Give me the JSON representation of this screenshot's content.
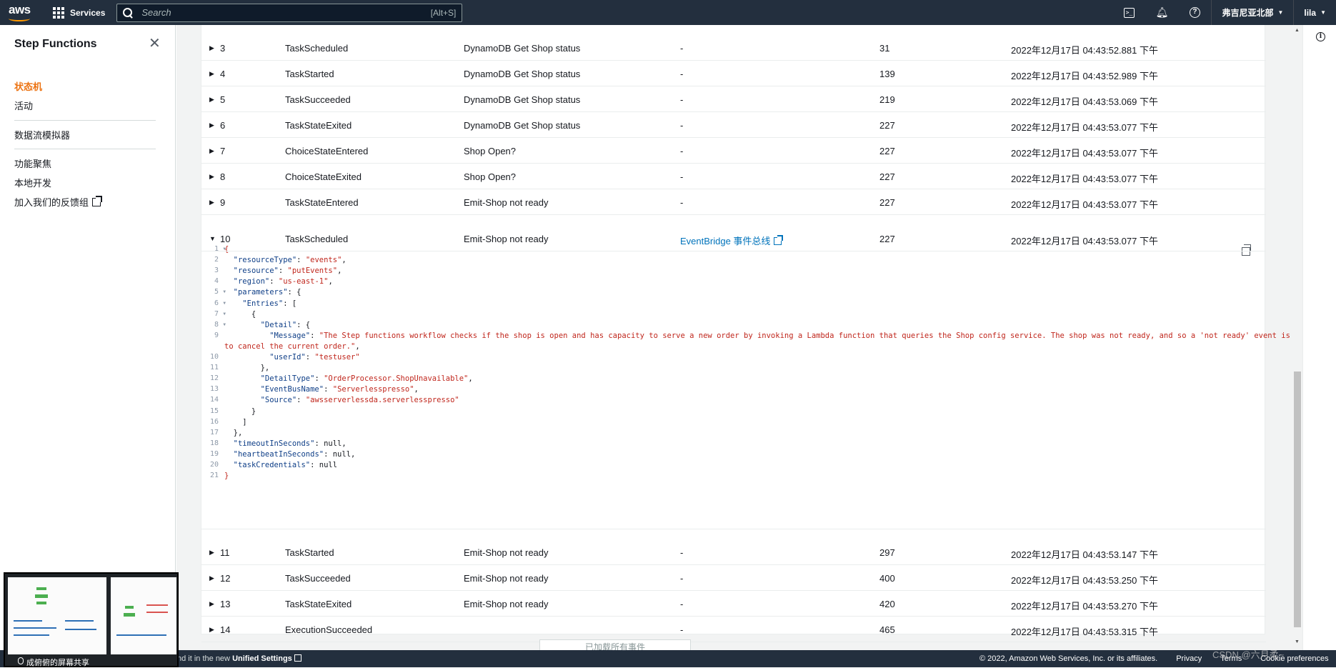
{
  "topnav": {
    "logo_text": "aws",
    "services_label": "Services",
    "search_placeholder": "Search",
    "search_shortcut": "[Alt+S]",
    "region": "弗吉尼亚北部",
    "user": "lila"
  },
  "sidebar": {
    "title": "Step Functions",
    "items": [
      {
        "label": "状态机",
        "active": true
      },
      {
        "label": "活动"
      },
      {
        "label": "数据流模拟器"
      },
      {
        "label": "功能聚焦"
      },
      {
        "label": "本地开发"
      },
      {
        "label": "加入我们的反馈组"
      }
    ]
  },
  "events": [
    {
      "id": "3",
      "type": "TaskScheduled",
      "step": "DynamoDB Get Shop status",
      "resource": "-",
      "elapsed_ms": "31",
      "timestamp": "2022年12月17日 04:43:52.881 下午",
      "expanded": false
    },
    {
      "id": "4",
      "type": "TaskStarted",
      "step": "DynamoDB Get Shop status",
      "resource": "-",
      "elapsed_ms": "139",
      "timestamp": "2022年12月17日 04:43:52.989 下午",
      "expanded": false
    },
    {
      "id": "5",
      "type": "TaskSucceeded",
      "step": "DynamoDB Get Shop status",
      "resource": "-",
      "elapsed_ms": "219",
      "timestamp": "2022年12月17日 04:43:53.069 下午",
      "expanded": false
    },
    {
      "id": "6",
      "type": "TaskStateExited",
      "step": "DynamoDB Get Shop status",
      "resource": "-",
      "elapsed_ms": "227",
      "timestamp": "2022年12月17日 04:43:53.077 下午",
      "expanded": false
    },
    {
      "id": "7",
      "type": "ChoiceStateEntered",
      "step": "Shop Open?",
      "resource": "-",
      "elapsed_ms": "227",
      "timestamp": "2022年12月17日 04:43:53.077 下午",
      "expanded": false
    },
    {
      "id": "8",
      "type": "ChoiceStateExited",
      "step": "Shop Open?",
      "resource": "-",
      "elapsed_ms": "227",
      "timestamp": "2022年12月17日 04:43:53.077 下午",
      "expanded": false
    },
    {
      "id": "9",
      "type": "TaskStateEntered",
      "step": "Emit-Shop not ready",
      "resource": "-",
      "elapsed_ms": "227",
      "timestamp": "2022年12月17日 04:43:53.077 下午",
      "expanded": false
    },
    {
      "id": "10",
      "type": "TaskScheduled",
      "step": "Emit-Shop not ready",
      "resource": "EventBridge 事件总线",
      "elapsed_ms": "227",
      "timestamp": "2022年12月17日 04:43:53.077 下午",
      "expanded": true
    },
    {
      "id": "11",
      "type": "TaskStarted",
      "step": "Emit-Shop not ready",
      "resource": "-",
      "elapsed_ms": "297",
      "timestamp": "2022年12月17日 04:43:53.147 下午",
      "expanded": false
    },
    {
      "id": "12",
      "type": "TaskSucceeded",
      "step": "Emit-Shop not ready",
      "resource": "-",
      "elapsed_ms": "400",
      "timestamp": "2022年12月17日 04:43:53.250 下午",
      "expanded": false
    },
    {
      "id": "13",
      "type": "TaskStateExited",
      "step": "Emit-Shop not ready",
      "resource": "-",
      "elapsed_ms": "420",
      "timestamp": "2022年12月17日 04:43:53.270 下午",
      "expanded": false
    },
    {
      "id": "14",
      "type": "ExecutionSucceeded",
      "step": "",
      "resource": "-",
      "elapsed_ms": "465",
      "timestamp": "2022年12月17日 04:43:53.315 下午",
      "expanded": false
    }
  ],
  "code_lines": [
    "{",
    "  \"resourceType\": \"events\",",
    "  \"resource\": \"putEvents\",",
    "  \"region\": \"us-east-1\",",
    "  \"parameters\": {",
    "    \"Entries\": [",
    "      {",
    "        \"Detail\": {",
    "          \"Message\": \"The Step functions workflow checks if the shop is open and has capacity to serve a new order by invoking a Lambda function that queries the Shop config service. The shop was not ready, and so a 'not ready' event is emitted",
    "to cancel the current order.\",",
    "          \"userId\": \"testuser\"",
    "        },",
    "        \"DetailType\": \"OrderProcessor.ShopUnavailable\",",
    "        \"EventBusName\": \"Serverlesspresso\",",
    "        \"Source\": \"awsserverlessda.serverlesspresso\"",
    "      }",
    "    ]",
    "  },",
    "  \"timeoutInSeconds\": null,",
    "  \"heartbeatInSeconds\": null,",
    "  \"taskCredentials\": null",
    "}"
  ],
  "line_numbers": [
    "1",
    "2",
    "3",
    "4",
    "5",
    "6",
    "7",
    "8",
    "9",
    "",
    "10",
    "11",
    "12",
    "13",
    "14",
    "15",
    "16",
    "17",
    "18",
    "19",
    "20",
    "21"
  ],
  "load_more_label": "已加载所有事件",
  "footer": {
    "left_text": "nd it in the new",
    "left_link": "Unified Settings",
    "copyright": "© 2022, Amazon Web Services, Inc. or its affiliates.",
    "privacy": "Privacy",
    "terms": "Terms",
    "cookies": "Cookie preferences"
  },
  "screen_share_label": "成俯俯的屏幕共享",
  "watermark": "CSDN @六月柔~"
}
